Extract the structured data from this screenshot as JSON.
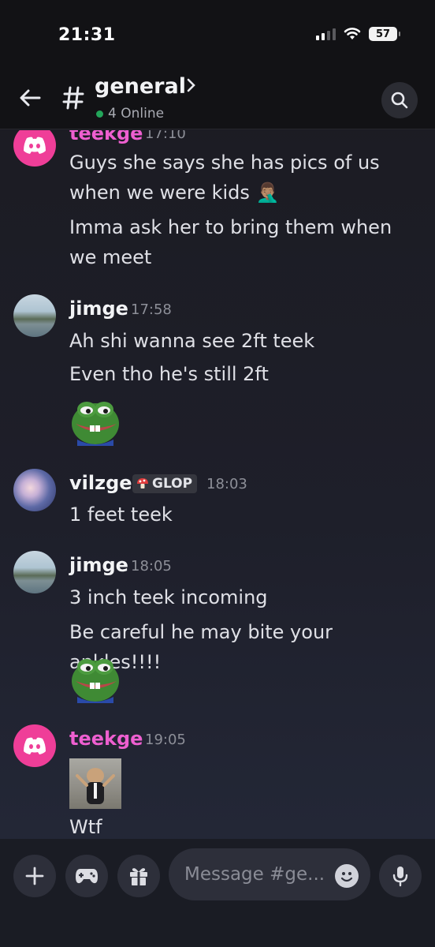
{
  "status_bar": {
    "time": "21:31",
    "battery": "57"
  },
  "header": {
    "channel_name": "general",
    "online": "4 Online"
  },
  "messages": [
    {
      "user": "teekge",
      "time": "17:10",
      "lines": [
        "Guys she says she has pics of us when we were kids 🤦🏽‍♂️",
        "Imma ask her to bring them when we meet"
      ]
    },
    {
      "user": "jimge",
      "time": "17:58",
      "lines": [
        "Ah shi wanna see 2ft teek",
        "Even tho he's still 2ft"
      ]
    },
    {
      "user": "vilzge",
      "role": "GLOP",
      "time": "18:03",
      "lines": [
        "1 feet teek"
      ]
    },
    {
      "user": "jimge",
      "time": "18:05",
      "lines": [
        "3 inch teek incoming",
        "Be careful he may bite your ankles!!!!"
      ]
    },
    {
      "user": "teekge",
      "time": "19:05",
      "lines": [
        "Wtf"
      ]
    }
  ],
  "composer": {
    "placeholder": "Message #ge..."
  },
  "colors": {
    "accent_teek": "#ee5fd0",
    "online_green": "#23a55a",
    "discord_avatar": "#ef3e98"
  }
}
